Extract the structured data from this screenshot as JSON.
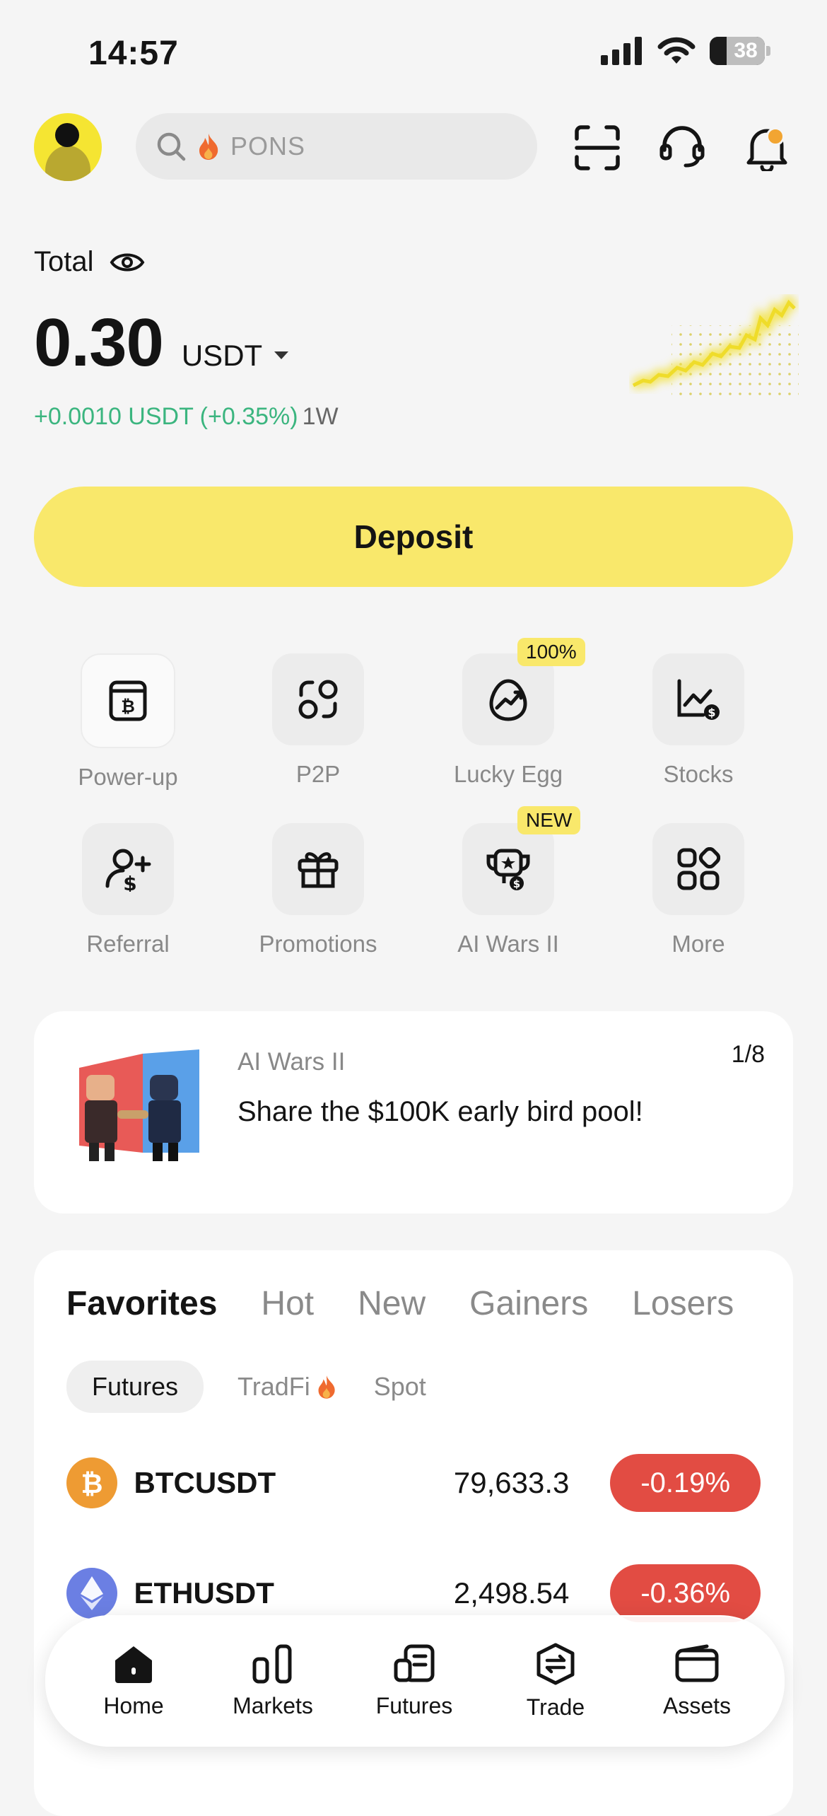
{
  "status_bar": {
    "time": "14:57",
    "battery": "38"
  },
  "header": {
    "search_placeholder": "PONS"
  },
  "balance": {
    "total_label": "Total",
    "amount": "0.30",
    "currency": "USDT",
    "change": "+0.0010 USDT (+0.35%)",
    "period": "1W"
  },
  "deposit_label": "Deposit",
  "shortcuts": [
    {
      "label": "Power-up",
      "icon": "power-up-icon"
    },
    {
      "label": "P2P",
      "icon": "p2p-icon"
    },
    {
      "label": "Lucky Egg",
      "icon": "lucky-egg-icon",
      "badge": "100%"
    },
    {
      "label": "Stocks",
      "icon": "stocks-icon"
    },
    {
      "label": "Referral",
      "icon": "referral-icon"
    },
    {
      "label": "Promotions",
      "icon": "gift-icon"
    },
    {
      "label": "AI Wars II",
      "icon": "trophy-icon",
      "badge": "NEW"
    },
    {
      "label": "More",
      "icon": "more-grid-icon"
    }
  ],
  "banner": {
    "subtitle": "AI Wars II",
    "title": "Share the $100K early bird pool!",
    "pager": "1/8"
  },
  "markets": {
    "tabs": [
      "Favorites",
      "Hot",
      "New",
      "Gainers",
      "Losers"
    ],
    "subtabs": [
      "Futures",
      "TradFi",
      "Spot"
    ],
    "rows": [
      {
        "symbol": "BTCUSDT",
        "price": "79,633.3",
        "change": "-0.19%",
        "coin_color": "#ee9b33"
      },
      {
        "symbol": "ETHUSDT",
        "price": "2,498.54",
        "change": "-0.36%",
        "coin_color": "#6b7fe3"
      }
    ]
  },
  "nav": [
    {
      "label": "Home",
      "icon": "home-icon"
    },
    {
      "label": "Markets",
      "icon": "markets-icon"
    },
    {
      "label": "Futures",
      "icon": "futures-icon"
    },
    {
      "label": "Trade",
      "icon": "trade-icon"
    },
    {
      "label": "Assets",
      "icon": "wallet-icon"
    }
  ],
  "colors": {
    "accent": "#f9e86b",
    "positive": "#3bb57f",
    "negative": "#e24c43"
  }
}
